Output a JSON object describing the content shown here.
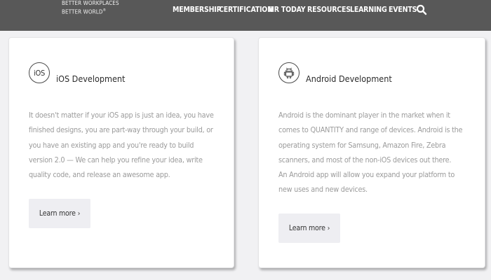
{
  "header": {
    "brand_line1": "BETTER WORKPLACES",
    "brand_line2": "BETTER WORLD",
    "brand_mark": "®",
    "nav": [
      "MEMBERSHIP",
      "CERTIFICATION",
      "HR TODAY",
      "RESOURCES",
      "LEARNING",
      "EVENTS"
    ],
    "search_icon": "search-icon",
    "colors": {
      "bar": "#585858",
      "text": "#ffffff"
    }
  },
  "cards": [
    {
      "icon_text": "iOS",
      "icon": "ios-icon",
      "title": "iOS Development",
      "body": [
        "It doesn't matter if your iOS app is just an idea, you have finished designs, you are part-way through your build, or you have an existing app and you're ready to build version 2.0 — We can help you refine your idea, write quality code, and release an awesome app."
      ],
      "button": "Learn more",
      "button_chevron": "›"
    },
    {
      "icon": "android-icon",
      "title": "Android Development",
      "body": [
        "Android is the dominant player in the market when it comes to QUANTITY and range of devices. Android is the operating system for Samsung, Amazon Fire, Zebra scanners, and most of the non-iOS devices out there.",
        "An Android app will allow you expand your platform to new uses and new devices."
      ],
      "button": "Learn more",
      "button_chevron": "›"
    }
  ]
}
